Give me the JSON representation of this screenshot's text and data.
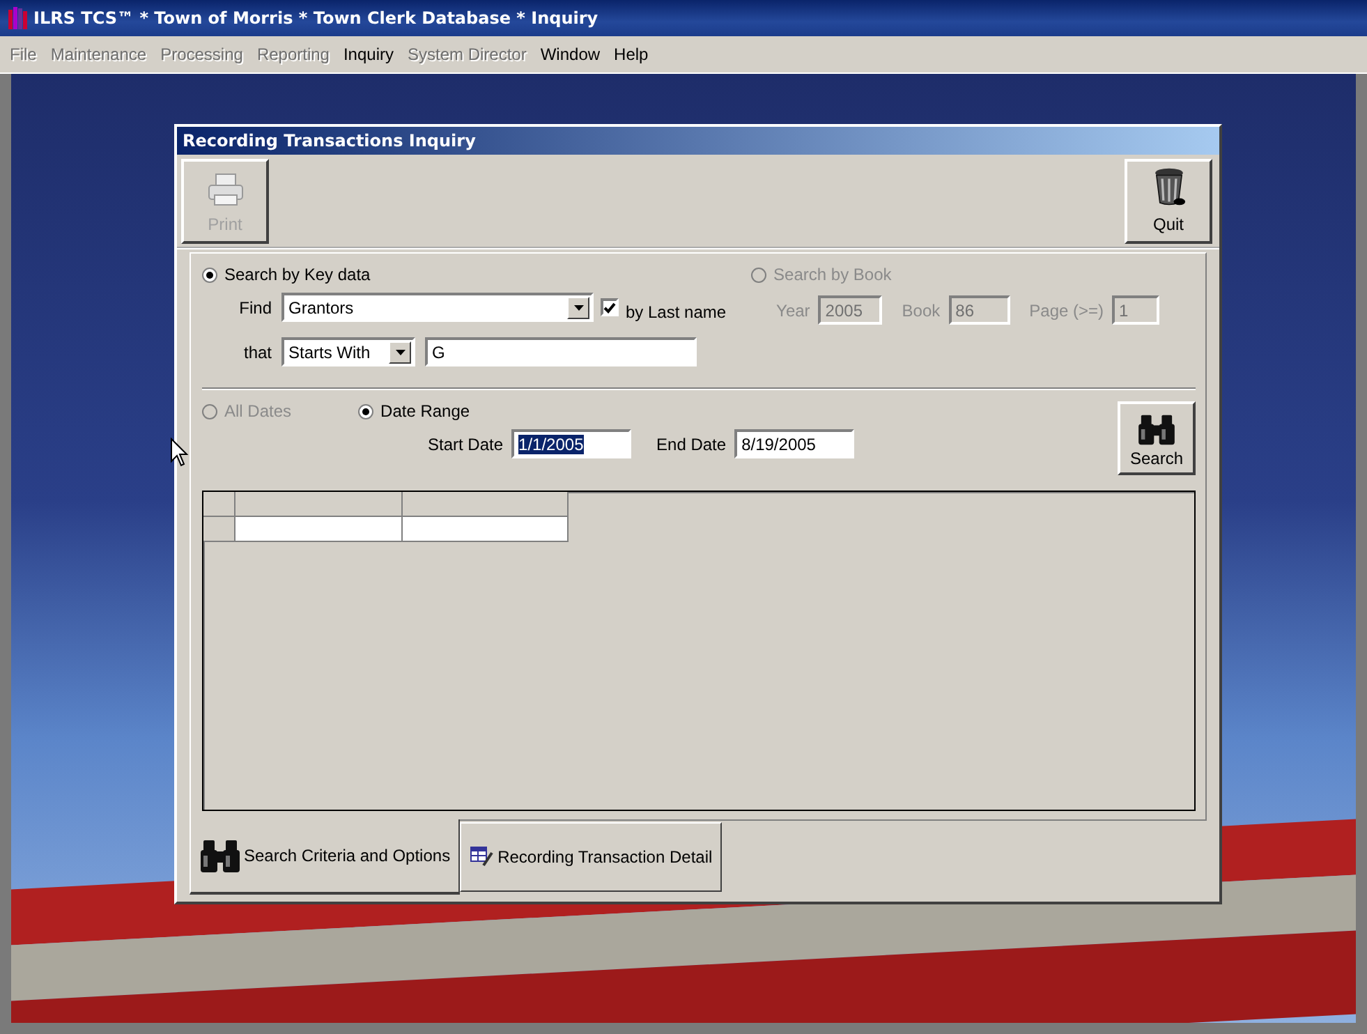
{
  "window": {
    "title": "ILRS TCS™ * Town of Morris * Town Clerk Database * Inquiry"
  },
  "menu": [
    {
      "label": "File",
      "disabled": true
    },
    {
      "label": "Maintenance",
      "disabled": true
    },
    {
      "label": "Processing",
      "disabled": true
    },
    {
      "label": "Reporting",
      "disabled": true
    },
    {
      "label": "Inquiry",
      "disabled": false
    },
    {
      "label": "System Director",
      "disabled": true
    },
    {
      "label": "Window",
      "disabled": false
    },
    {
      "label": "Help",
      "disabled": false
    }
  ],
  "dialog": {
    "title": "Recording Transactions Inquiry",
    "toolbar": [
      {
        "kind": "print",
        "label": "Print",
        "disabled": true
      },
      {
        "kind": "quit",
        "label": "Quit",
        "disabled": false
      }
    ],
    "key_search": {
      "label": "Search by Key data",
      "selected": true,
      "find_label": "Find",
      "find_value": "Grantors",
      "by_last_name": {
        "label": "by Last name",
        "checked": true
      },
      "that_label": "that",
      "match_value": "Starts With",
      "text_value": "G"
    },
    "book_search": {
      "label": "Search by Book",
      "selected": false,
      "disabled": true,
      "fields": [
        {
          "label": "Year",
          "value": "2005"
        },
        {
          "label": "Book",
          "value": "86"
        },
        {
          "label": "Page (>=)",
          "value": "1"
        }
      ]
    },
    "date_options": [
      {
        "label": "All Dates",
        "selected": false,
        "disabled": true
      },
      {
        "label": "Date Range",
        "selected": true,
        "disabled": false
      }
    ],
    "start_date": {
      "label": "Start Date",
      "value": "1/1/2005",
      "highlighted": true
    },
    "end_date": {
      "label": "End Date",
      "value": "8/19/2005",
      "highlighted": false
    },
    "search_button": {
      "label": "Search"
    },
    "tabs": [
      {
        "kind": "search",
        "label": "Search Criteria and Options",
        "selected": true
      },
      {
        "kind": "detail",
        "label": "Recording Transaction Detail",
        "selected": false
      }
    ]
  }
}
